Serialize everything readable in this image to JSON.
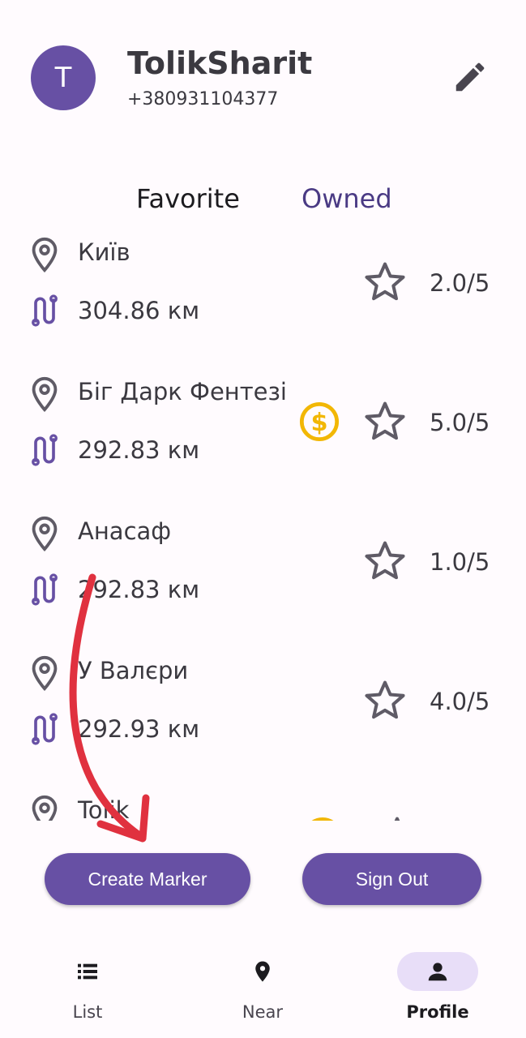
{
  "profile": {
    "avatar_letter": "T",
    "name": "TolikSharit",
    "phone": "+380931104377"
  },
  "tabs": [
    {
      "label": "Favorite",
      "selected": false
    },
    {
      "label": "Owned",
      "selected": true
    }
  ],
  "markers": [
    {
      "name": "Київ",
      "distance": "304.86 км",
      "rating": "2.0/5",
      "paid": false
    },
    {
      "name": "Біг Дарк Фентезі",
      "distance": "292.83 км",
      "rating": "5.0/5",
      "paid": true
    },
    {
      "name": "Анасаф",
      "distance": "292.83 км",
      "rating": "1.0/5",
      "paid": false
    },
    {
      "name": "У Валєри",
      "distance": "292.93 км",
      "rating": "4.0/5",
      "paid": false
    },
    {
      "name": "Tolik",
      "distance": "",
      "rating": "",
      "paid": true
    }
  ],
  "actions": {
    "create_marker": "Create Marker",
    "sign_out": "Sign Out"
  },
  "bottom_nav": [
    {
      "label": "List",
      "icon": "list-icon",
      "active": false
    },
    {
      "label": "Near",
      "icon": "location-pin-icon",
      "active": false
    },
    {
      "label": "Profile",
      "icon": "person-icon",
      "active": true
    }
  ],
  "colors": {
    "primary": "#6750a4",
    "route_icon": "#6750a4",
    "coin": "#f2b705",
    "annotation_arrow": "#e0313f"
  }
}
